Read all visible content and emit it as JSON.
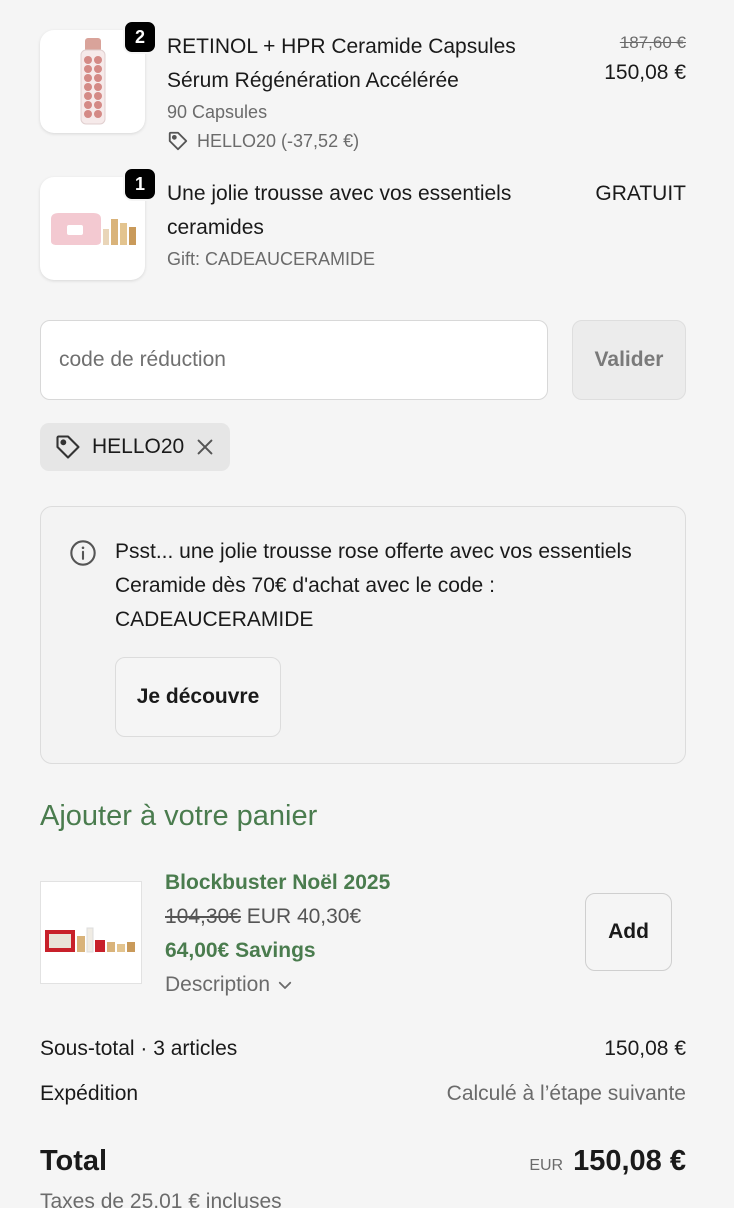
{
  "items": [
    {
      "quantity": "2",
      "title_line1": "RETINOL + HPR Ceramide Capsules",
      "title_line2": "Sérum Régénération Accélérée",
      "variant": "90 Capsules",
      "discount": "HELLO20 (-37,52 €)",
      "price_old": "187,60 €",
      "price": "150,08 €",
      "image_icon": "capsule-bottle-icon"
    },
    {
      "quantity": "1",
      "title_line1": "Une jolie trousse avec vos essentiels",
      "title_line2": "ceramides",
      "variant": "Gift: CADEAUCERAMIDE",
      "price": "GRATUIT",
      "image_icon": "gift-pouch-icon"
    }
  ],
  "discount_form": {
    "placeholder": "code de réduction",
    "value": "",
    "submit_label": "Valider"
  },
  "applied_code": {
    "code": "HELLO20",
    "tag_icon": "tag-icon",
    "remove_icon": "close-icon"
  },
  "info_box": {
    "icon": "info-icon",
    "text": "Psst... une jolie trousse rose offerte avec vos essentiels Ceramide dès 70€ d'achat avec le code : CADEAUCERAMIDE",
    "button_label": "Je découvre"
  },
  "upsell": {
    "heading": "Ajouter à votre panier",
    "product": {
      "title": "Blockbuster Noël 2025",
      "price_old": "104,30€",
      "price": "EUR 40,30€",
      "savings": "64,00€ Savings",
      "description_label": "Description",
      "add_label": "Add",
      "image_icon": "gift-set-icon"
    }
  },
  "summary": {
    "subtotal_label": "Sous-total · 3 articles",
    "subtotal_value": "150,08 €",
    "shipping_label": "Expédition",
    "shipping_value": "Calculé à l’étape suivante",
    "total_label": "Total",
    "total_currency": "EUR",
    "total_value": "150,08 €",
    "taxes_note": "Taxes de 25,01 € incluses"
  },
  "colors": {
    "accent_green": "#4a7c4e",
    "background": "#f5f5f5",
    "badge": "#000000"
  }
}
